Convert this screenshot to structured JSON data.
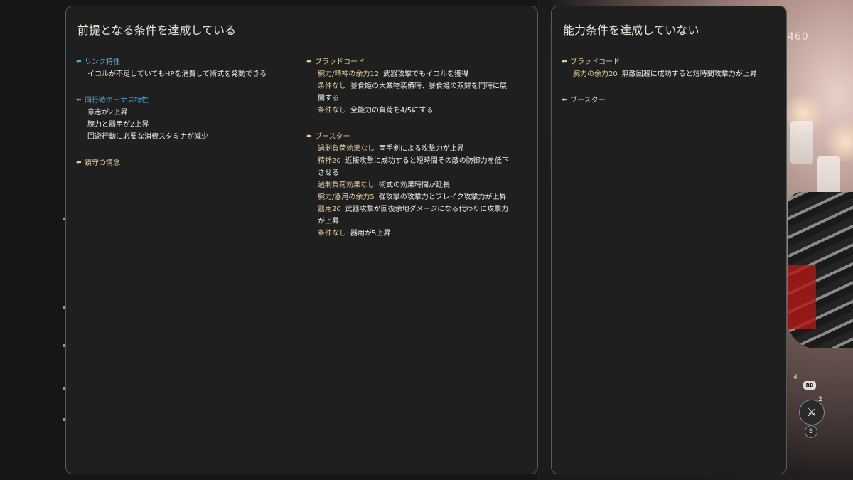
{
  "left_panel": {
    "title": "前提となる条件を達成している",
    "column_a": {
      "groups": [
        {
          "header": "リンク特性",
          "entries": [
            {
              "text": "イコルが不足していてもHPを消費して術式を発動できる"
            }
          ]
        },
        {
          "header": "同行時ボーナス特性",
          "entries": [
            {
              "text": "意志が2上昇"
            },
            {
              "text": "腕力と器用が2上昇"
            },
            {
              "text": "回避行動に必要な消費スタミナが減少"
            }
          ]
        },
        {
          "header": "鎖守の情念",
          "entries": []
        }
      ]
    },
    "column_b": {
      "groups": [
        {
          "header": "ブラッドコード",
          "entries": [
            {
              "condition": "腕力/精神の余力12",
              "text": "武器攻撃でもイコルを獲得"
            },
            {
              "condition": "条件なし",
              "text": "暴食姫の大業物装備時、暴食姫の双鉾を同時に展開する"
            },
            {
              "condition": "条件なし",
              "text": "全能力の負荷を4/5にする"
            }
          ]
        },
        {
          "header": "ブースター",
          "entries": [
            {
              "condition": "過剰負荷効果なし",
              "text": "両手剣による攻撃力が上昇"
            },
            {
              "condition": "精神20",
              "text": "近接攻撃に成功すると短時間その敵の防御力を低下させる"
            },
            {
              "condition": "過剰負荷効果なし",
              "text": "術式の効果時間が延長"
            },
            {
              "condition": "腕力/器用の余力5",
              "text": "強攻撃の攻撃力とブレイク攻撃力が上昇"
            },
            {
              "condition": "器用20",
              "text": "武器攻撃が回復余地ダメージになる代わりに攻撃力が上昇"
            },
            {
              "condition": "条件なし",
              "text": "器用が5上昇"
            }
          ]
        }
      ]
    }
  },
  "right_panel": {
    "title": "能力条件を達成していない",
    "groups": [
      {
        "header": "ブラッドコード",
        "entries": [
          {
            "condition": "腕力の余力20",
            "text": "無敵回避に成功すると短時間攻撃力が上昇"
          }
        ]
      },
      {
        "header": "ブースター",
        "entries": []
      }
    ]
  },
  "hud": {
    "counter": "460",
    "rb_label": "RB",
    "b_label": "B",
    "slot_count_a": "4",
    "slot_count_b": "2"
  },
  "colors": {
    "panel_bg": "#1f1f1f",
    "panel_border": "#5a5a5a",
    "accent_blue": "#4ab4e8",
    "accent_gold": "#e3cc9a",
    "text": "#e8e6e2"
  }
}
